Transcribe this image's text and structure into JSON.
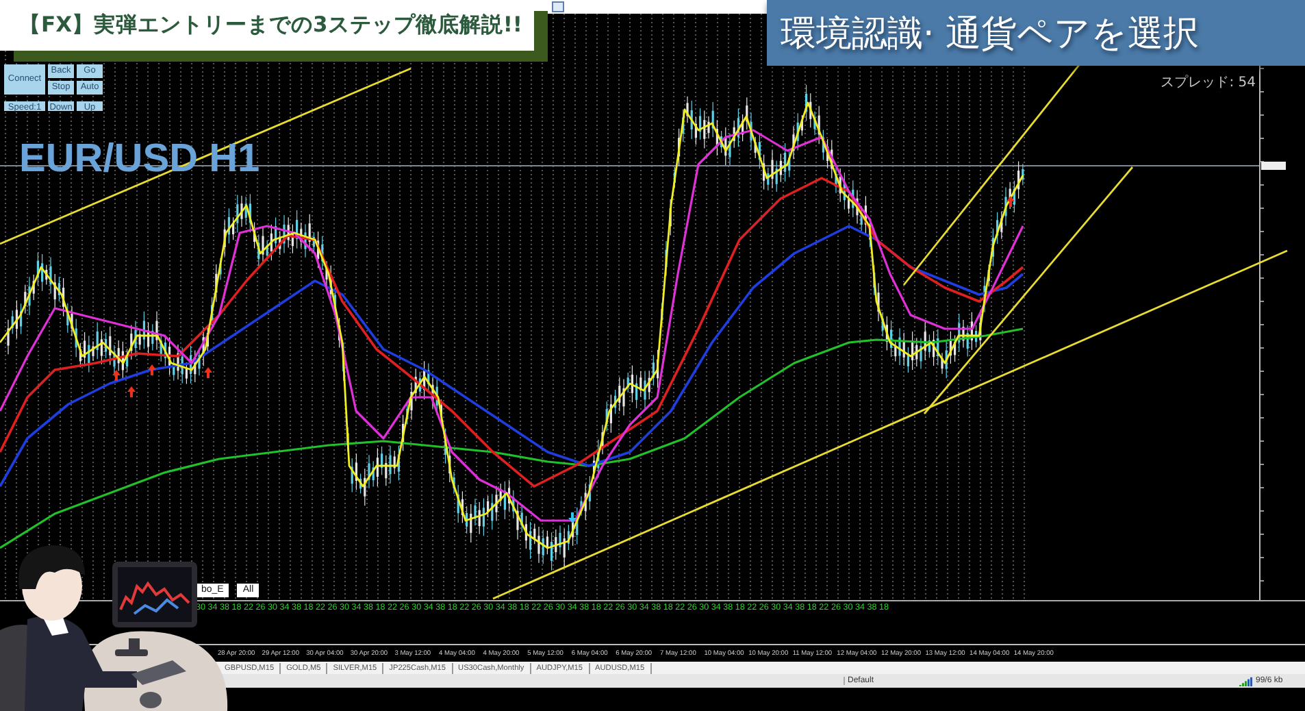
{
  "headline_banner": {
    "text": "【FX】実弾エントリーまでの3ステップ徹底解説!!"
  },
  "step_banner": {
    "text": "環境認識· 通貨ペアを選択"
  },
  "chart": {
    "symbol_label": "EUR/USD H1",
    "spread_label": "スプレッド: 54",
    "control_buttons": [
      "Back",
      "Go",
      "Connect",
      "Stop",
      "Auto",
      "Speed:1",
      "Down",
      "Up"
    ],
    "filter_buttons": [
      "bo_E",
      "All"
    ],
    "tick_row": "30 34 38 18 22 26 30 34 38 18 22 26 30 34 38 18 22 26 30 34 38 18 22 26 30 34 38 18 22 26 30 34 38 18 22 26 30 34 38 18 22 26 30 34 38 18 22 26 30 34 38 18 22 26 30 34 38 18",
    "time_labels": [
      "28 Apr 20:00",
      "29 Apr 12:00",
      "30 Apr 04:00",
      "30 Apr 20:00",
      "3 May 12:00",
      "4 May 04:00",
      "4 May 20:00",
      "5 May 12:00",
      "6 May 04:00",
      "6 May 20:00",
      "7 May 12:00",
      "10 May 04:00",
      "10 May 20:00",
      "11 May 12:00",
      "12 May 04:00",
      "12 May 20:00",
      "13 May 12:00",
      "14 May 04:00",
      "14 May 20:00"
    ]
  },
  "symbol_tabs": [
    {
      "label": "GBPUSD,M15",
      "selected": false
    },
    {
      "label": "GOLD,M5",
      "selected": false
    },
    {
      "label": "SILVER,M15",
      "selected": false
    },
    {
      "label": "JP225Cash,M15",
      "selected": false
    },
    {
      "label": "US30Cash,Monthly",
      "selected": false
    },
    {
      "label": "AUDJPY,M15",
      "selected": false
    },
    {
      "label": "AUDUSD,M15",
      "selected": false
    }
  ],
  "status_bar": {
    "profile": "Default",
    "traffic": "99/6 kb"
  }
}
